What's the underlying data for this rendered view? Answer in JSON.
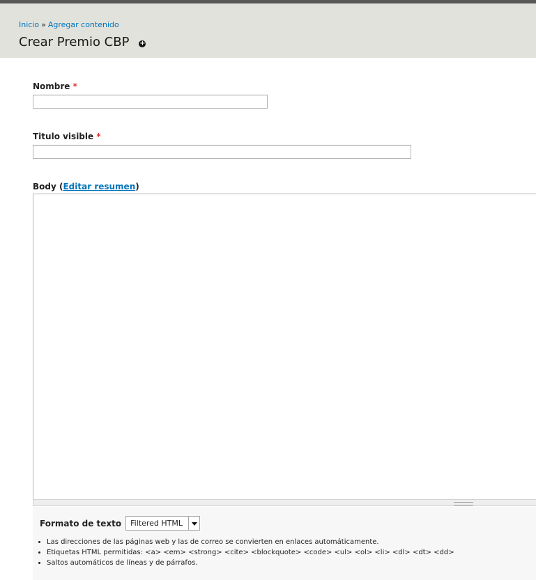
{
  "header": {
    "breadcrumb": {
      "home": "Inicio",
      "separator": "»",
      "parent": "Agregar contenido"
    },
    "title": "Crear Premio CBP",
    "shortcut_icon": "plus-circle-icon"
  },
  "fields": {
    "nombre": {
      "label": "Nombre",
      "required_marker": "*",
      "value": ""
    },
    "titulo": {
      "label": "Titulo visible",
      "required_marker": "*",
      "value": ""
    },
    "body": {
      "label": "Body",
      "open_paren": "(",
      "summary_link": "Editar resumen",
      "close_paren": ")",
      "value": ""
    }
  },
  "text_format": {
    "label": "Formato de texto",
    "selected": "Filtered HTML",
    "tips": [
      "Las direcciones de las páginas web y las de correo se convierten en enlaces automáticamente.",
      "Etiquetas HTML permitidas: <a> <em> <strong> <cite> <blockquote> <code> <ul> <ol> <li> <dl> <dt> <dd>",
      "Saltos automáticos de líneas y de párrafos."
    ]
  },
  "colors": {
    "link": "#0074bd",
    "required": "#e0322b",
    "header_bg": "#e2e2dc"
  }
}
